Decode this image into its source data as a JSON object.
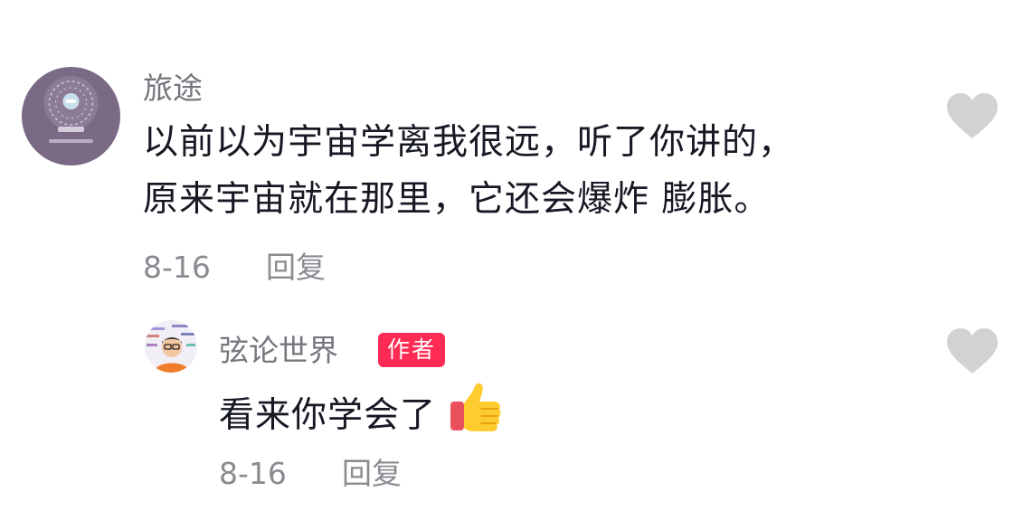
{
  "comment": {
    "username": "旅途",
    "text_lines": [
      "以前以为宇宙学离我很远，听了你讲的，",
      "原来宇宙就在那里，它还会爆炸 膨胀。"
    ],
    "date": "8-16",
    "reply_label": "回复",
    "avatar_icon": "purple-qr-avatar",
    "like_icon": "heart-icon"
  },
  "reply": {
    "username": "弦论世界",
    "badge": "作者",
    "text": "看来你学会了",
    "emoji_icon": "thumbs-up-icon",
    "date": "8-16",
    "reply_label": "回复",
    "avatar_icon": "cartoon-physicist-avatar",
    "like_icon": "heart-icon"
  },
  "colors": {
    "badge": "#fe2c55",
    "heart": "#d2d2d4",
    "meta_text": "#8a8b91",
    "username": "#75757d"
  }
}
